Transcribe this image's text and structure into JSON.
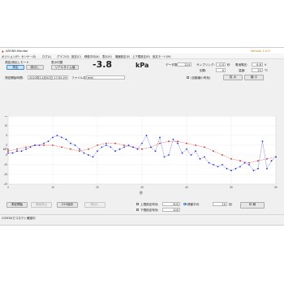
{
  "window": {
    "title": "ARONE-Monitor",
    "version": "Version 1.0.0"
  },
  "menu": [
    "ポジション(P)",
    "センサー(S)",
    "ログ(L)",
    "グラフ(G)",
    "設定(C)",
    "移動平均(A)",
    "表示(V)",
    "機器設定(E)",
    "上下限設定(R)",
    "設定モード(M)"
  ],
  "mode": {
    "label": "測定/読出しモード",
    "measure": "測定",
    "read": "読出し"
  },
  "display": {
    "label": "表示切替",
    "value": "リアルタイム値"
  },
  "reading": {
    "value": "-3.8",
    "unit": "kPa"
  },
  "info": {
    "data_count_label": "データ数:",
    "data_count": "124",
    "sampling_label": "サンプリング:",
    "sampling": "0.5",
    "sampling_unit": "秒",
    "battery_label": "電池電圧:",
    "battery": "6.8",
    "battery_unit": "V",
    "count_label": "回数:",
    "count": "0",
    "temp_label": "温度:",
    "temp": "25",
    "temp_unit": "℃"
  },
  "start_time": {
    "label": "測定開始時間:",
    "value": "2023年11月02日 17:05:29"
  },
  "file": {
    "label": "ファイル名:",
    "value": "test"
  },
  "autoscale": {
    "label": "(自動縮小有効)",
    "zoom_in": "拡 大",
    "zoom_out": "縮 小"
  },
  "chart_data": {
    "type": "line",
    "xlabel": "秒",
    "ylabel": "kPa",
    "x_ticks": [
      "0",
      "10",
      "20",
      "30",
      "40",
      "50",
      "60"
    ],
    "y_ticks": [
      "15",
      "10",
      "5",
      "0",
      "-5",
      "-10",
      "-15",
      "-20"
    ],
    "xlim": [
      0,
      60
    ],
    "ylim": [
      -20,
      15
    ],
    "grid": true,
    "series": [
      {
        "color": "#d42020",
        "x": [
          0,
          2,
          4,
          6,
          8,
          10,
          12,
          14,
          16,
          18,
          20,
          22,
          24,
          26,
          28,
          30,
          32,
          34,
          36,
          38,
          40,
          42,
          44,
          46,
          48,
          50,
          52,
          54,
          56,
          58,
          60
        ],
        "y": [
          -3,
          -2,
          -1,
          0,
          0,
          0,
          -1,
          -2,
          -3,
          -2,
          0,
          1,
          1,
          0,
          -1,
          -2,
          -1,
          1,
          2,
          2,
          1,
          0,
          -1,
          -3,
          -5,
          -7,
          -8,
          -9,
          -8,
          -7,
          -6
        ]
      },
      {
        "color": "#1c2fd8",
        "x": [
          0,
          1,
          2,
          3,
          4,
          5,
          6,
          7,
          8,
          9,
          10,
          11,
          12,
          13,
          14,
          15,
          16,
          17,
          18,
          19,
          20,
          21,
          22,
          23,
          24,
          25,
          26,
          27,
          28,
          29,
          30,
          31,
          32,
          33,
          34,
          35,
          36,
          37,
          38,
          39,
          40,
          41,
          42,
          43,
          44,
          45,
          46,
          47,
          48,
          49,
          50,
          51,
          52,
          53,
          54,
          55,
          56,
          57,
          58,
          59,
          60
        ],
        "y": [
          -4,
          -4,
          -3,
          -3,
          -2,
          -1,
          0,
          0,
          1,
          2,
          4,
          5,
          4,
          3,
          1,
          0,
          -2,
          -4,
          -5,
          -6,
          -3,
          -1,
          0,
          -1,
          -3,
          -2,
          -1,
          0,
          -1,
          -2,
          1,
          5,
          -1,
          -3,
          4,
          -6,
          -5,
          3,
          1,
          -4,
          -2,
          -5,
          -3,
          -7,
          -6,
          -9,
          -10,
          -11,
          -10,
          -12,
          -13,
          -12,
          -11,
          -9,
          -10,
          -13,
          -12,
          2,
          -12,
          -8,
          -6
        ]
      }
    ]
  },
  "buttons": {
    "start": "測定開始",
    "stop": "測定停止",
    "csv": "CSV保存",
    "read_out": "読出し",
    "print": "印 刷"
  },
  "limits": {
    "upper_label": "上限設定有効",
    "upper": "500",
    "lower_label": "下限設定有効",
    "lower": "100",
    "moving_avg_label": "移動平均",
    "moving_avg": "10",
    "moving_avg_unit": "回"
  },
  "status": {
    "text": "COM30でコネクト確認中"
  }
}
